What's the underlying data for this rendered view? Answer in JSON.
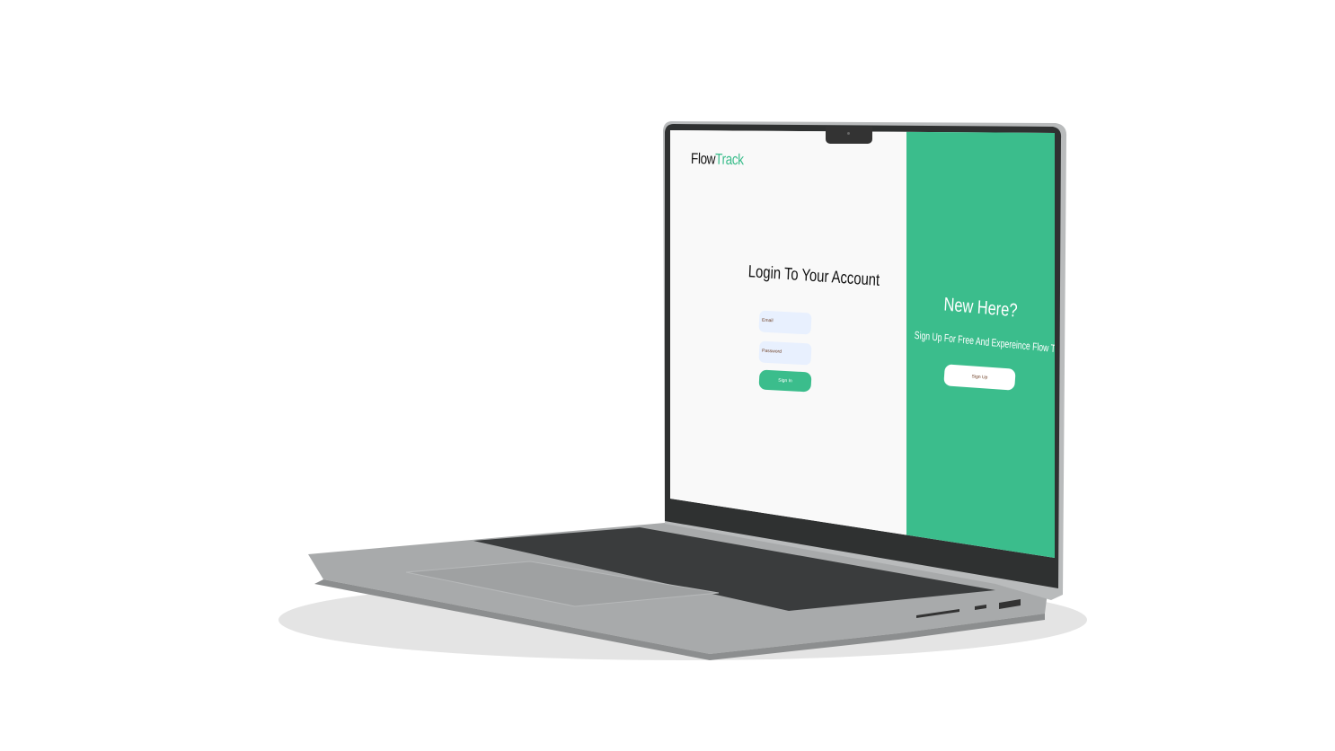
{
  "app": {
    "logo_part1": "Flow",
    "logo_part2": "Track"
  },
  "login": {
    "title": "Login To Your Account",
    "email_placeholder": "Email",
    "password_placeholder": "Password",
    "signin_label": "Sign In"
  },
  "signup_panel": {
    "title": "New Here?",
    "subtitle": "Sign Up For Free And Expereince Flow Track",
    "signup_label": "Sign Up"
  },
  "colors": {
    "accent": "#3bbd8c",
    "input_bg": "#e8f0fe",
    "page_bg": "#f9f9f9"
  }
}
